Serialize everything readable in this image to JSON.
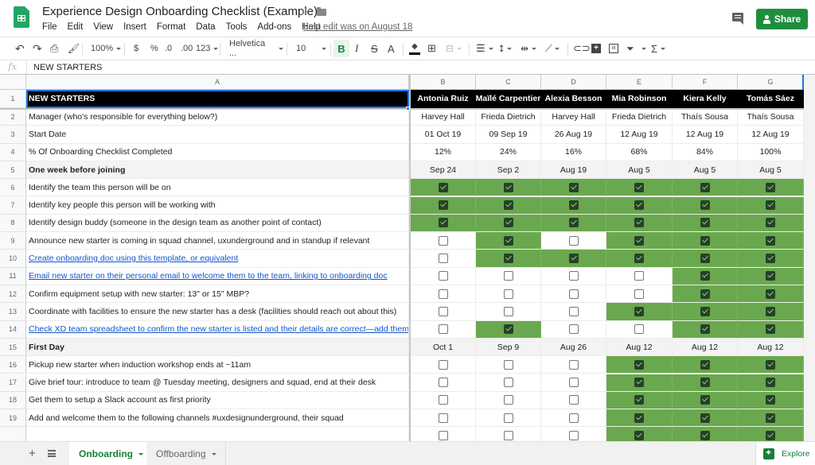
{
  "app": {
    "title": "Experience Design Onboarding Checklist (Example)",
    "menu": [
      "File",
      "Edit",
      "View",
      "Insert",
      "Format",
      "Data",
      "Tools",
      "Add-ons",
      "Help"
    ],
    "last_edit": "Last edit was on August 18",
    "share_label": "Share",
    "accent": "#1e8e3e"
  },
  "toolbar": {
    "zoom": "100%",
    "currency": "$",
    "percent": "%",
    "decrease_decimal": ".0",
    "increase_decimal": ".00",
    "number_format": "123",
    "font": "Helvetica ...",
    "font_size": "10",
    "bold": "B",
    "italic": "I",
    "strikethrough": "S",
    "text_color": "A",
    "sum": "Σ"
  },
  "formula": {
    "fx_label": "fx",
    "value": "NEW STARTERS"
  },
  "grid": {
    "column_letters": [
      "A",
      "B",
      "C",
      "D",
      "E",
      "F",
      "G"
    ],
    "done_color": "#6aa84f",
    "people": [
      "Antonia Ruiz",
      "Maïlé Carpentier",
      "Alexia Besson",
      "Mia Robinson",
      "Kiera Kelly",
      "Tomás Sáez"
    ],
    "rows": [
      {
        "num": "1",
        "type": "header",
        "label": "NEW STARTERS"
      },
      {
        "num": "2",
        "type": "text",
        "label": "Manager (who's responsible for everything below?)",
        "values": [
          "Harvey Hall",
          "Frieda Dietrich",
          "Harvey Hall",
          "Frieda Dietrich",
          "Thaís Sousa",
          "Thaís Sousa"
        ]
      },
      {
        "num": "3",
        "type": "text",
        "label": "Start Date",
        "values": [
          "01 Oct 19",
          "09 Sep 19",
          "26 Aug 19",
          "12 Aug 19",
          "12 Aug 19",
          "12 Aug 19"
        ]
      },
      {
        "num": "4",
        "type": "text",
        "label": "% Of Onboarding Checklist Completed",
        "values": [
          "12%",
          "24%",
          "16%",
          "68%",
          "84%",
          "100%"
        ]
      },
      {
        "num": "5",
        "type": "section",
        "label": "One week before joining",
        "values": [
          "Sep 24",
          "Sep 2",
          "Aug 19",
          "Aug 5",
          "Aug 5",
          "Aug 5"
        ]
      },
      {
        "num": "6",
        "type": "check",
        "label": "Identify the team this person will be on",
        "checks": [
          true,
          true,
          true,
          true,
          true,
          true
        ]
      },
      {
        "num": "7",
        "type": "check",
        "label": "Identify key people this person will be working with",
        "checks": [
          true,
          true,
          true,
          true,
          true,
          true
        ]
      },
      {
        "num": "8",
        "type": "check",
        "label": "Identify design buddy (someone in the design team as another point of contact)",
        "checks": [
          true,
          true,
          true,
          true,
          true,
          true
        ]
      },
      {
        "num": "9",
        "type": "check",
        "label": "Announce new starter is coming in squad channel, uxunderground and in standup if relevant",
        "checks": [
          false,
          true,
          false,
          true,
          true,
          true
        ]
      },
      {
        "num": "10",
        "type": "check",
        "link": true,
        "label": "Create onboarding doc using this template, or equivalent",
        "checks": [
          false,
          true,
          true,
          true,
          true,
          true
        ]
      },
      {
        "num": "11",
        "type": "check",
        "link": true,
        "label": "Email new starter on their personal email to welcome them to the team, linking to onboarding doc",
        "checks": [
          false,
          false,
          false,
          false,
          true,
          true
        ]
      },
      {
        "num": "12",
        "type": "check",
        "label": "Confirm equipment setup with new starter: 13\" or 15\" MBP?",
        "checks": [
          false,
          false,
          false,
          false,
          true,
          true
        ]
      },
      {
        "num": "13",
        "type": "check",
        "label": "Coordinate with facilities to ensure the new starter has a desk (facilities should reach out about this)",
        "checks": [
          false,
          false,
          false,
          true,
          true,
          true
        ]
      },
      {
        "num": "14",
        "type": "check",
        "link": true,
        "label": "Check XD team spreadsheet to confirm the new starter is listed and their details are correct—add them if not",
        "checks": [
          false,
          true,
          false,
          false,
          true,
          true
        ]
      },
      {
        "num": "15",
        "type": "section",
        "label": "First Day",
        "values": [
          "Oct 1",
          "Sep 9",
          "Aug 26",
          "Aug 12",
          "Aug 12",
          "Aug 12"
        ]
      },
      {
        "num": "16",
        "type": "check",
        "label": "Pickup new starter when induction workshop ends at ~11am",
        "checks": [
          false,
          false,
          false,
          true,
          true,
          true
        ]
      },
      {
        "num": "17",
        "type": "check",
        "label": "Give brief tour: introduce to team @ Tuesday meeting, designers and squad, end at their desk",
        "checks": [
          false,
          false,
          false,
          true,
          true,
          true
        ]
      },
      {
        "num": "18",
        "type": "check",
        "label": "Get them to setup a Slack account as first priority",
        "checks": [
          false,
          false,
          false,
          true,
          true,
          true
        ]
      },
      {
        "num": "19",
        "type": "check",
        "label": "Add and welcome them to the following channels #uxdesignunderground, their squad",
        "checks": [
          false,
          false,
          false,
          true,
          true,
          true
        ]
      },
      {
        "num": "",
        "type": "check",
        "label": "",
        "checks": [
          false,
          false,
          false,
          true,
          true,
          true
        ]
      }
    ]
  },
  "sheets": {
    "tabs": [
      {
        "label": "Onboarding",
        "active": true
      },
      {
        "label": "Offboarding",
        "active": false
      }
    ],
    "add_label": "+",
    "explore_label": "Explore"
  }
}
